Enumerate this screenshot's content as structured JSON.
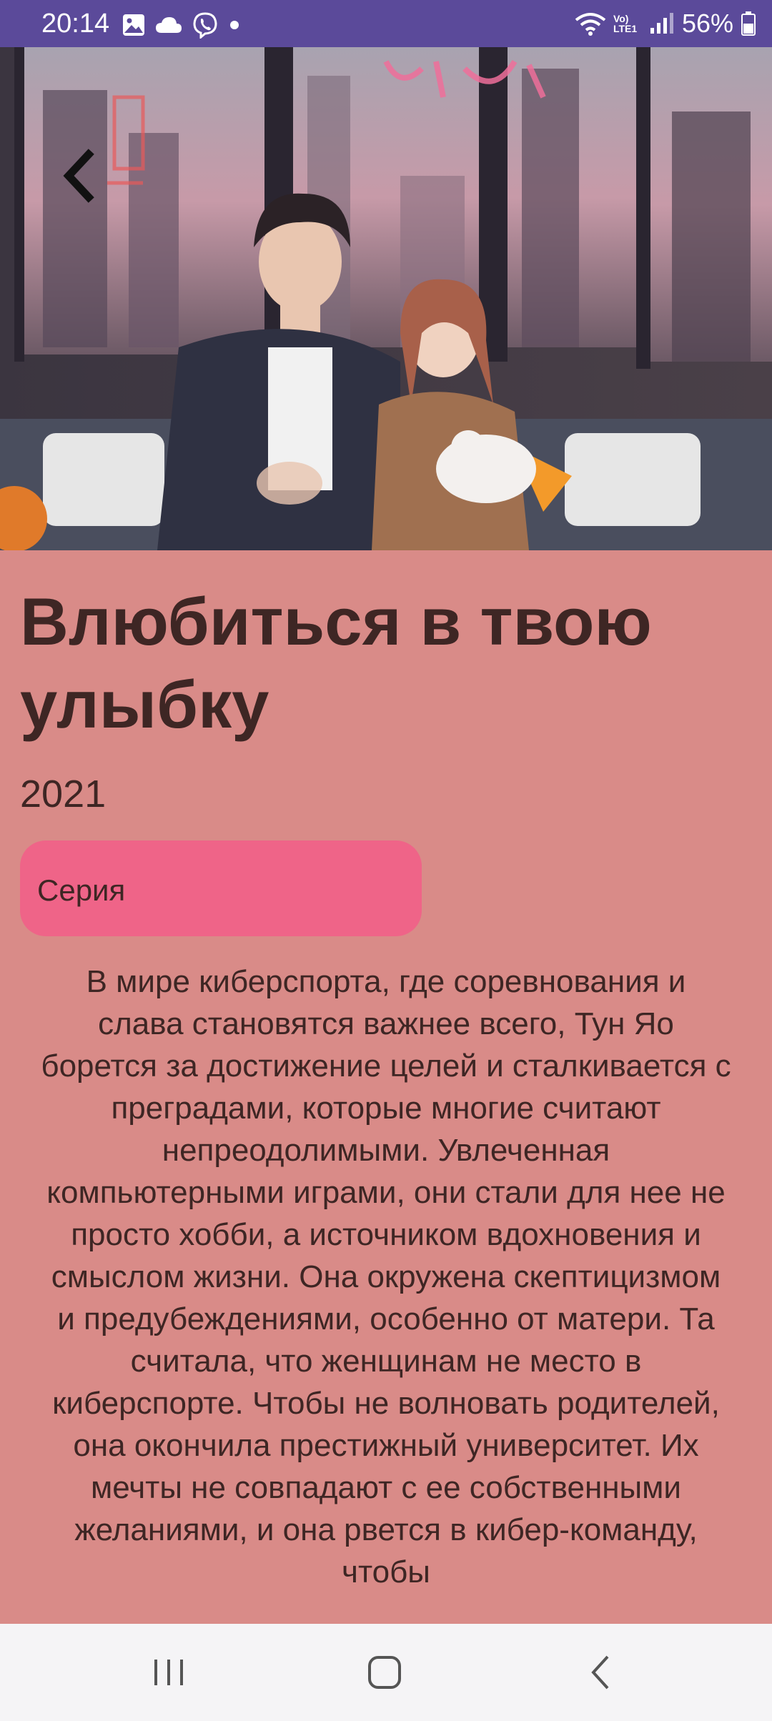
{
  "status_bar": {
    "time": "20:14",
    "network_label": "Vo) LTE1",
    "battery": "56%"
  },
  "hero": {
    "image_alt": "Постер: пара на диване в комнате с видом на ночной город"
  },
  "movie": {
    "title": "Влюбиться в твою улыбку",
    "year": "2021",
    "type": "Серия",
    "description": "В мире киберспорта, где соревнования и слава становятся важнее всего, Тун Яо борется за достижение целей и сталкивается с преградами, которые многие считают непреодолимыми. Увлеченная компьютерными играми, они стали для нее не просто хобби, а источником вдохновения и смыслом жизни. Она окружена скептицизмом и предубеждениями, особенно от матери. Та считала, что женщинам не место в киберспорте. Чтобы не волновать родителей, она окончила престижный университет. Их мечты не совпадают с ее собственными желаниями, и она рвется в кибер-команду, чтобы"
  },
  "colors": {
    "status_bar": "#5b4a9a",
    "background": "#d98b88",
    "chip": "#ef6488",
    "text": "#3e2624",
    "nav_bar": "#f5f4f6"
  },
  "icons": [
    "photo-icon",
    "cloud-icon",
    "viber-icon",
    "dot-icon",
    "wifi-icon",
    "signal-icon",
    "battery-icon",
    "back-arrow-icon",
    "recents-icon",
    "home-icon",
    "nav-back-icon"
  ]
}
